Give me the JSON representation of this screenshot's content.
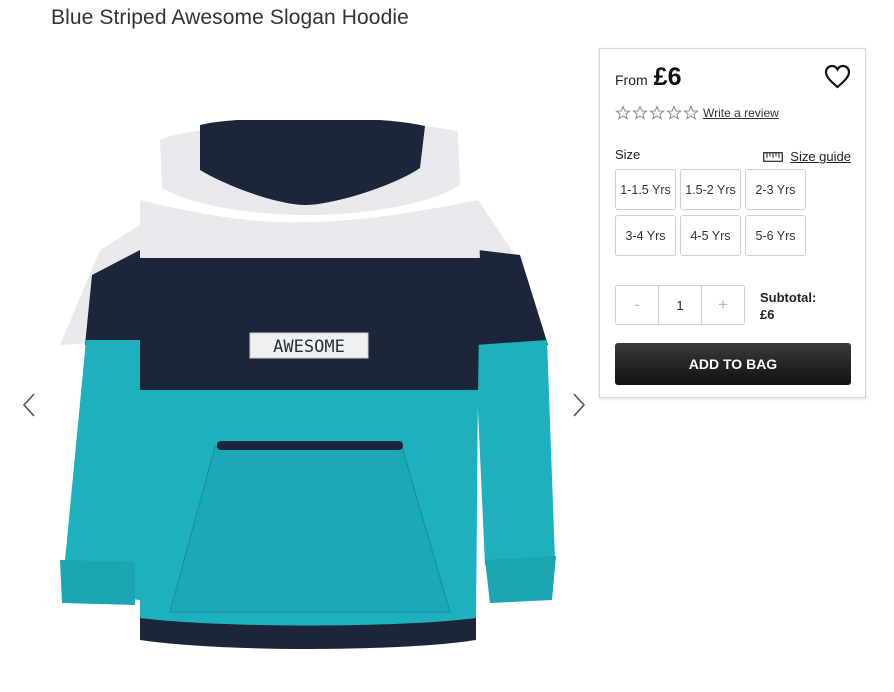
{
  "product": {
    "title": "Blue Striped Awesome Slogan Hoodie",
    "image_slogan": "AWESOME",
    "colors": {
      "light": "#e7e9ec",
      "navy": "#1c2638",
      "teal": "#1fb0bd"
    }
  },
  "purchase": {
    "from_label": "From",
    "price": "£6",
    "review_link": "Write a review",
    "rating_stars_filled": 0,
    "rating_stars_total": 5,
    "size_label": "Size",
    "size_guide_label": "Size guide",
    "sizes": [
      "1-1.5 Yrs",
      "1.5-2 Yrs",
      "2-3 Yrs",
      "3-4 Yrs",
      "4-5 Yrs",
      "5-6 Yrs"
    ],
    "qty_minus": "-",
    "qty_value": "1",
    "qty_plus": "+",
    "subtotal_label": "Subtotal:",
    "subtotal_value": "£6",
    "add_to_bag_label": "ADD TO BAG"
  },
  "icons": {
    "prev": "chevron-left-icon",
    "next": "chevron-right-icon",
    "wishlist": "heart-icon",
    "star": "star-outline-icon",
    "ruler": "ruler-icon"
  }
}
